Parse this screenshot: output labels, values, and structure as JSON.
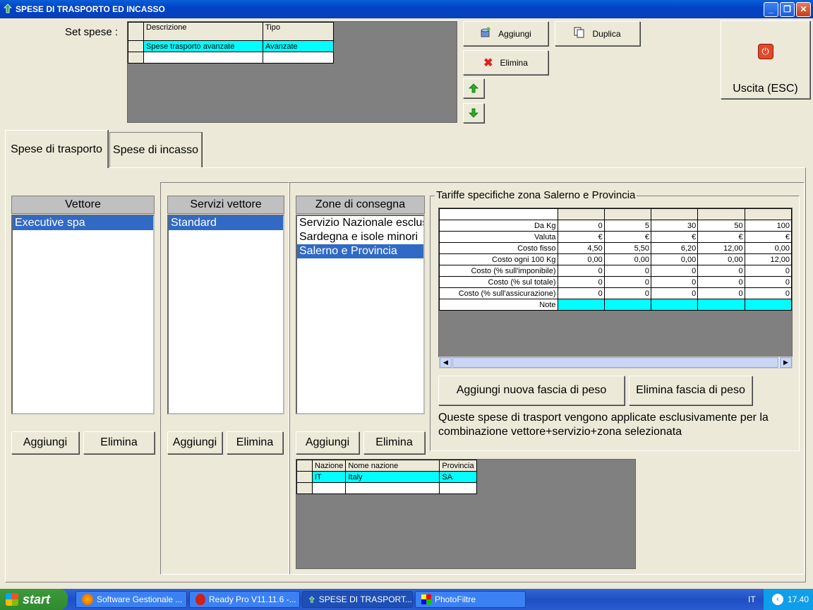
{
  "window": {
    "title": "SPESE DI TRASPORTO ED INCASSO"
  },
  "set_spese": {
    "label": "Set spese :",
    "columns": [
      "Descrizione",
      "Tipo"
    ],
    "rows": [
      {
        "descrizione": "Spese trasporto avanzate",
        "tipo": "Avanzate"
      }
    ]
  },
  "toolbar": {
    "aggiungi": "Aggiungi",
    "duplica": "Duplica",
    "elimina": "Elimina",
    "uscita": "Uscita (ESC)"
  },
  "tabs": [
    "Spese di trasporto",
    "Spese di incasso"
  ],
  "vettore": {
    "header": "Vettore",
    "items": [
      "Executive spa"
    ],
    "add": "Aggiungi",
    "remove": "Elimina"
  },
  "servizi": {
    "header": "Servizi vettore",
    "items": [
      "Standard"
    ],
    "add": "Aggiungi",
    "remove": "Elimina"
  },
  "zone": {
    "header": "Zone di consegna",
    "items": [
      "Servizio Nazionale esclus",
      "Sardegna e isole minori",
      "Salerno e Provincia"
    ],
    "add": "Aggiungi",
    "remove": "Elimina"
  },
  "tariffe": {
    "title": "Tariffe specifiche zona Salerno e Provincia",
    "rows": [
      {
        "label": "Da Kg",
        "values": [
          "0",
          "5",
          "30",
          "50",
          "100"
        ]
      },
      {
        "label": "Valuta",
        "values": [
          "€",
          "€",
          "€",
          "€",
          "€"
        ]
      },
      {
        "label": "Costo fisso",
        "values": [
          "4,50",
          "5,50",
          "6,20",
          "12,00",
          "0,00"
        ]
      },
      {
        "label": "Costo ogni 100 Kg",
        "values": [
          "0,00",
          "0,00",
          "0,00",
          "0,00",
          "12,00"
        ]
      },
      {
        "label": "Costo (% sull'imponibile)",
        "values": [
          "0",
          "0",
          "0",
          "0",
          "0"
        ]
      },
      {
        "label": "Costo (% sul totale)",
        "values": [
          "0",
          "0",
          "0",
          "0",
          "0"
        ]
      },
      {
        "label": "Costo (% sull'assicurazione)",
        "values": [
          "0",
          "0",
          "0",
          "0",
          "0"
        ]
      },
      {
        "label": "Note",
        "values": [
          "",
          "",
          "",
          "",
          ""
        ]
      }
    ],
    "add_band": "Aggiungi nuova fascia di peso",
    "remove_band": "Elimina fascia di peso",
    "note": "Queste spese di trasport vengono applicate esclusivamente per la combinazione vettore+servizio+zona selezionata"
  },
  "nazioni": {
    "columns": [
      "Nazione",
      "Nome nazione",
      "Provincia"
    ],
    "rows": [
      {
        "nazione": "IT",
        "nome": "Italy",
        "provincia": "SA"
      }
    ]
  },
  "taskbar": {
    "start": "start",
    "tasks": [
      "Software Gestionale ...",
      "Ready Pro V11.11.6 -...",
      "SPESE DI TRASPORT...",
      "PhotoFiltre"
    ],
    "lang": "IT",
    "time": "17.40"
  }
}
